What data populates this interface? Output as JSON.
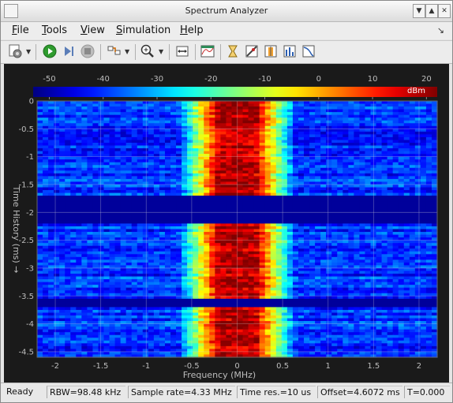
{
  "window": {
    "title": "Spectrum Analyzer"
  },
  "menu": [
    {
      "mnemonic": "F",
      "rest": "ile"
    },
    {
      "mnemonic": "T",
      "rest": "ools"
    },
    {
      "mnemonic": "V",
      "rest": "iew"
    },
    {
      "mnemonic": "S",
      "rest": "imulation"
    },
    {
      "mnemonic": "H",
      "rest": "elp"
    }
  ],
  "toolbar": {
    "icons": [
      "settings-icon",
      "run-icon",
      "step-forward-icon",
      "stop-icon",
      "highlight-icon",
      "zoom-in-icon",
      "fit-axes-icon",
      "spectrum-settings-icon",
      "cursor-icon",
      "peak-finder-icon",
      "channel-measurements-icon",
      "distortion-icon",
      "ccdf-icon"
    ]
  },
  "colorbar": {
    "ticks": [
      "-50",
      "-40",
      "-30",
      "-20",
      "-10",
      "0",
      "10",
      "20"
    ],
    "unit": "dBm",
    "min": -53,
    "max": 22
  },
  "axes": {
    "xlabel": "Frequency (MHz)",
    "ylabel": "Time History (ms) →",
    "xticks": [
      "-2",
      "-1.5",
      "-1",
      "-0.5",
      "0",
      "0.5",
      "1",
      "1.5",
      "2"
    ],
    "yticks": [
      "0",
      "-0.5",
      "-1",
      "-1.5",
      "-2",
      "-2.5",
      "-3",
      "-3.5",
      "-4",
      "-4.5"
    ],
    "xlim": [
      -2.2,
      2.2
    ],
    "ylim": [
      0,
      -4.6
    ]
  },
  "chart_data": {
    "type": "heatmap",
    "title": "",
    "xlabel": "Frequency (MHz)",
    "ylabel": "Time History (ms)",
    "xlim": [
      -2.2,
      2.2
    ],
    "ylim": [
      0,
      -4.6
    ],
    "color_range_dbm": [
      -53,
      22
    ],
    "colormap": "jet",
    "peak_center_mhz": 0,
    "peak_halfwidth_mhz": 0.2,
    "peak_level_dbm": 18,
    "noise_floor_dbm": -40,
    "gaps_ms": [
      [
        -1.7,
        -2.2
      ],
      [
        -3.55,
        -3.7
      ]
    ]
  },
  "status": {
    "ready": "Ready",
    "rbw": "RBW=98.48 kHz",
    "sample_rate": "Sample rate=4.33 MHz",
    "time_res": "Time res.=10 us",
    "offset": "Offset=4.6072 ms",
    "t": "T=0.000"
  }
}
